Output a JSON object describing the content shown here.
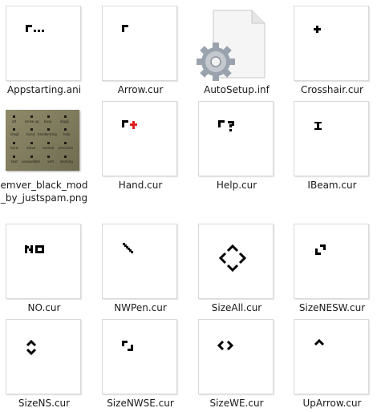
{
  "files": [
    {
      "name": "Appstarting.ani",
      "icon": "appstarting-cursor-icon"
    },
    {
      "name": "Arrow.cur",
      "icon": "arrow-cursor-icon"
    },
    {
      "name": "AutoSetup.inf",
      "icon": "settings-file-icon"
    },
    {
      "name": "Crosshair.cur",
      "icon": "crosshair-cursor-icon"
    },
    {
      "name": "emver_black_mod_by_justspam.png",
      "icon": "image-thumbnail"
    },
    {
      "name": "Hand.cur",
      "icon": "hand-cursor-icon"
    },
    {
      "name": "Help.cur",
      "icon": "help-cursor-icon"
    },
    {
      "name": "IBeam.cur",
      "icon": "ibeam-cursor-icon"
    },
    {
      "name": "NO.cur",
      "icon": "no-cursor-icon"
    },
    {
      "name": "NWPen.cur",
      "icon": "nwpen-cursor-icon"
    },
    {
      "name": "SizeAll.cur",
      "icon": "sizeall-cursor-icon"
    },
    {
      "name": "SizeNESW.cur",
      "icon": "sizenesw-cursor-icon"
    },
    {
      "name": "SizeNS.cur",
      "icon": "sizens-cursor-icon"
    },
    {
      "name": "SizeNWSE.cur",
      "icon": "sizenwse-cursor-icon"
    },
    {
      "name": "SizeWE.cur",
      "icon": "sizewe-cursor-icon"
    },
    {
      "name": "UpArrow.cur",
      "icon": "uparrow-cursor-icon"
    }
  ],
  "thumbnail_preview": {
    "rows": [
      [
        "alt",
        "arrow up",
        "busy",
        "diag1"
      ],
      [
        "diag2",
        "hand",
        "handwriting",
        "help"
      ],
      [
        "horiz",
        "move",
        "normal",
        "precision"
      ],
      [
        "text",
        "unavailable",
        "vert",
        "working"
      ]
    ]
  },
  "colors": {
    "hand_plus": "#e02020",
    "cursor": "#000000"
  }
}
